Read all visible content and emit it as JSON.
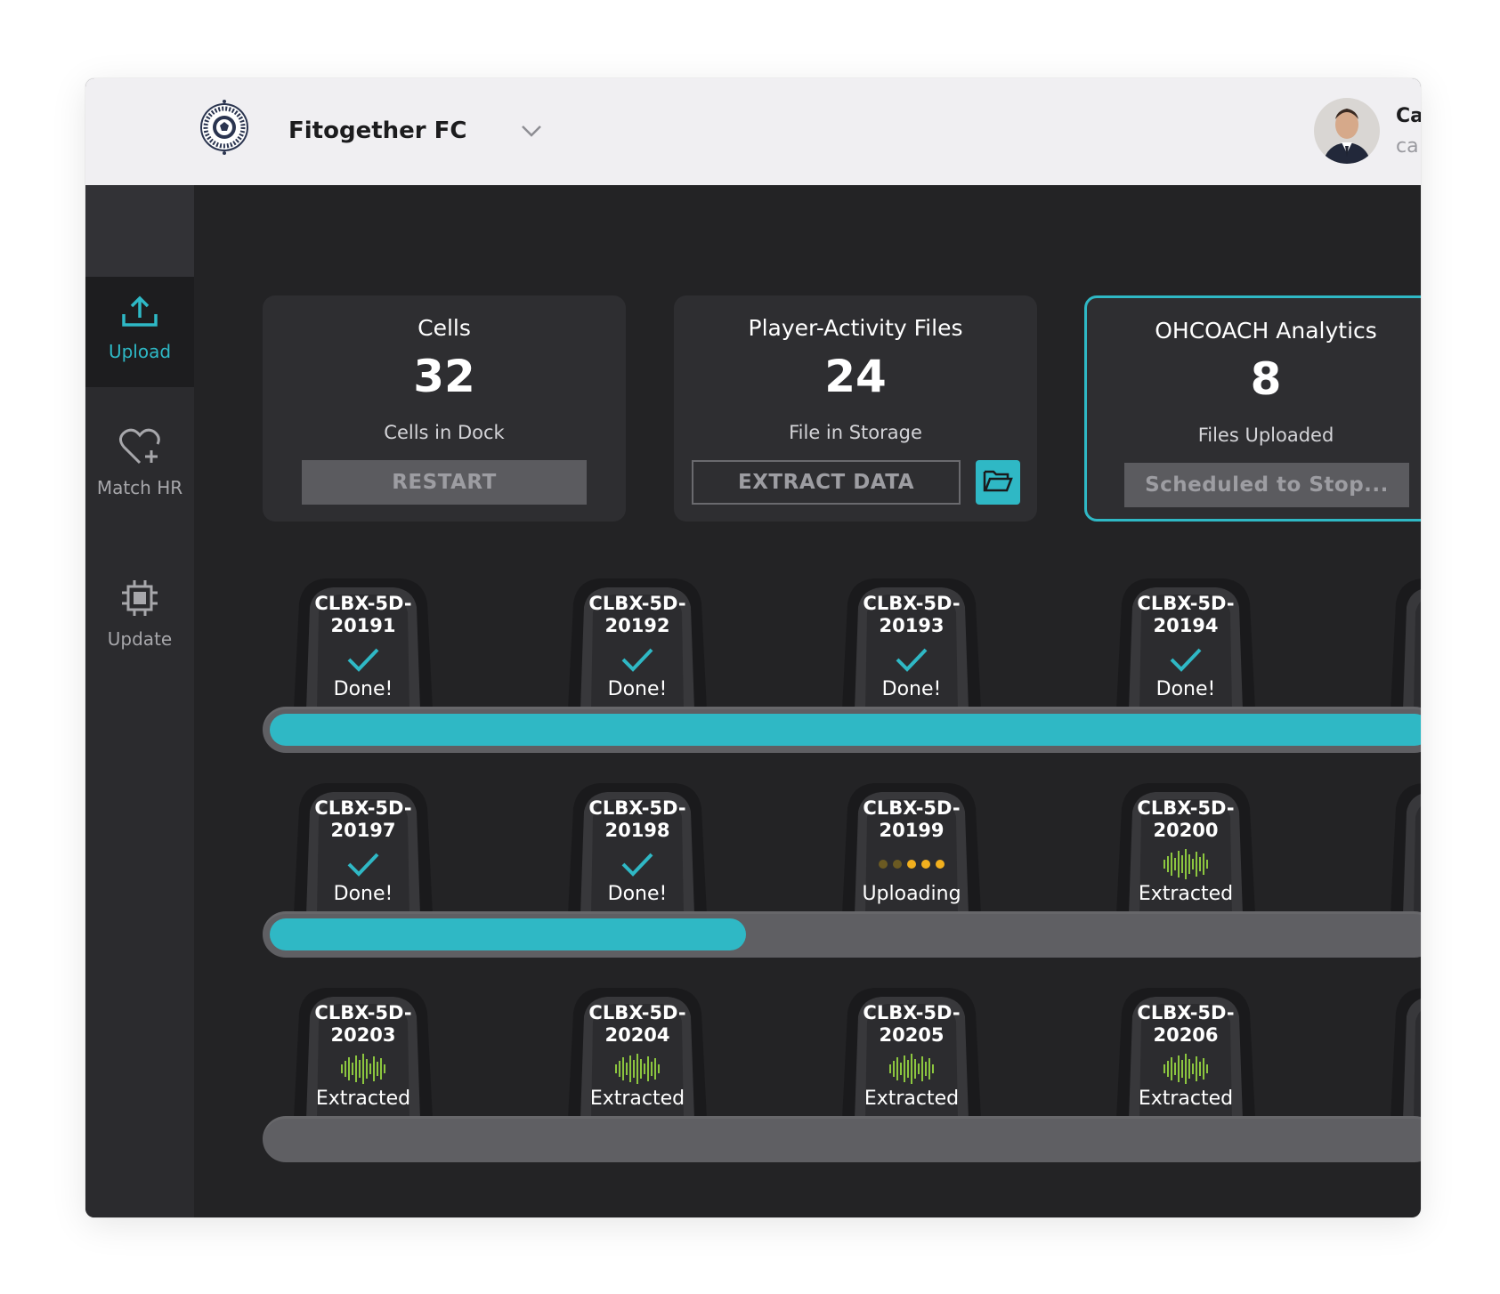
{
  "header": {
    "club_name": "Fitogether FC",
    "user_name": "Ca",
    "user_sub": "ca"
  },
  "sidebar": {
    "items": [
      {
        "label": "Upload",
        "icon": "upload-icon",
        "active": true
      },
      {
        "label": "Match HR",
        "icon": "heart-plus-icon",
        "active": false
      },
      {
        "label": "Update",
        "icon": "chip-icon",
        "active": false
      }
    ]
  },
  "cards": [
    {
      "title": "Cells",
      "value": "32",
      "subtitle": "Cells in Dock",
      "button": "RESTART"
    },
    {
      "title": "Player-Activity Files",
      "value": "24",
      "subtitle": "File in Storage",
      "button": "EXTRACT DATA",
      "extra_icon": "folder-open-icon"
    },
    {
      "title": "OHCOACH Analytics",
      "value": "8",
      "subtitle": "Files Uploaded",
      "button": "Scheduled to Stop..."
    }
  ],
  "dock_rows": [
    {
      "progress": 1.0,
      "cells": [
        {
          "id_line1": "CLBX-5D-",
          "id_line2": "20191",
          "status": "Done!",
          "icon": "check-icon"
        },
        {
          "id_line1": "CLBX-5D-",
          "id_line2": "20192",
          "status": "Done!",
          "icon": "check-icon"
        },
        {
          "id_line1": "CLBX-5D-",
          "id_line2": "20193",
          "status": "Done!",
          "icon": "check-icon"
        },
        {
          "id_line1": "CLBX-5D-",
          "id_line2": "20194",
          "status": "Done!",
          "icon": "check-icon"
        }
      ]
    },
    {
      "progress": 0.41,
      "cells": [
        {
          "id_line1": "CLBX-5D-",
          "id_line2": "20197",
          "status": "Done!",
          "icon": "check-icon"
        },
        {
          "id_line1": "CLBX-5D-",
          "id_line2": "20198",
          "status": "Done!",
          "icon": "check-icon"
        },
        {
          "id_line1": "CLBX-5D-",
          "id_line2": "20199",
          "status": "Uploading",
          "icon": "loading-dots-icon"
        },
        {
          "id_line1": "CLBX-5D-",
          "id_line2": "20200",
          "status": "Extracted",
          "icon": "waveform-icon"
        }
      ]
    },
    {
      "progress": 0.0,
      "cells": [
        {
          "id_line1": "CLBX-5D-",
          "id_line2": "20203",
          "status": "Extracted",
          "icon": "waveform-icon"
        },
        {
          "id_line1": "CLBX-5D-",
          "id_line2": "20204",
          "status": "Extracted",
          "icon": "waveform-icon"
        },
        {
          "id_line1": "CLBX-5D-",
          "id_line2": "20205",
          "status": "Extracted",
          "icon": "waveform-icon"
        },
        {
          "id_line1": "CLBX-5D-",
          "id_line2": "20206",
          "status": "Extracted",
          "icon": "waveform-icon"
        }
      ]
    }
  ],
  "colors": {
    "accent": "#2fb8c5",
    "waveform": "#8cc63f",
    "dots_dim": "#6b5a22",
    "dots_bright": "#f2b01e"
  }
}
